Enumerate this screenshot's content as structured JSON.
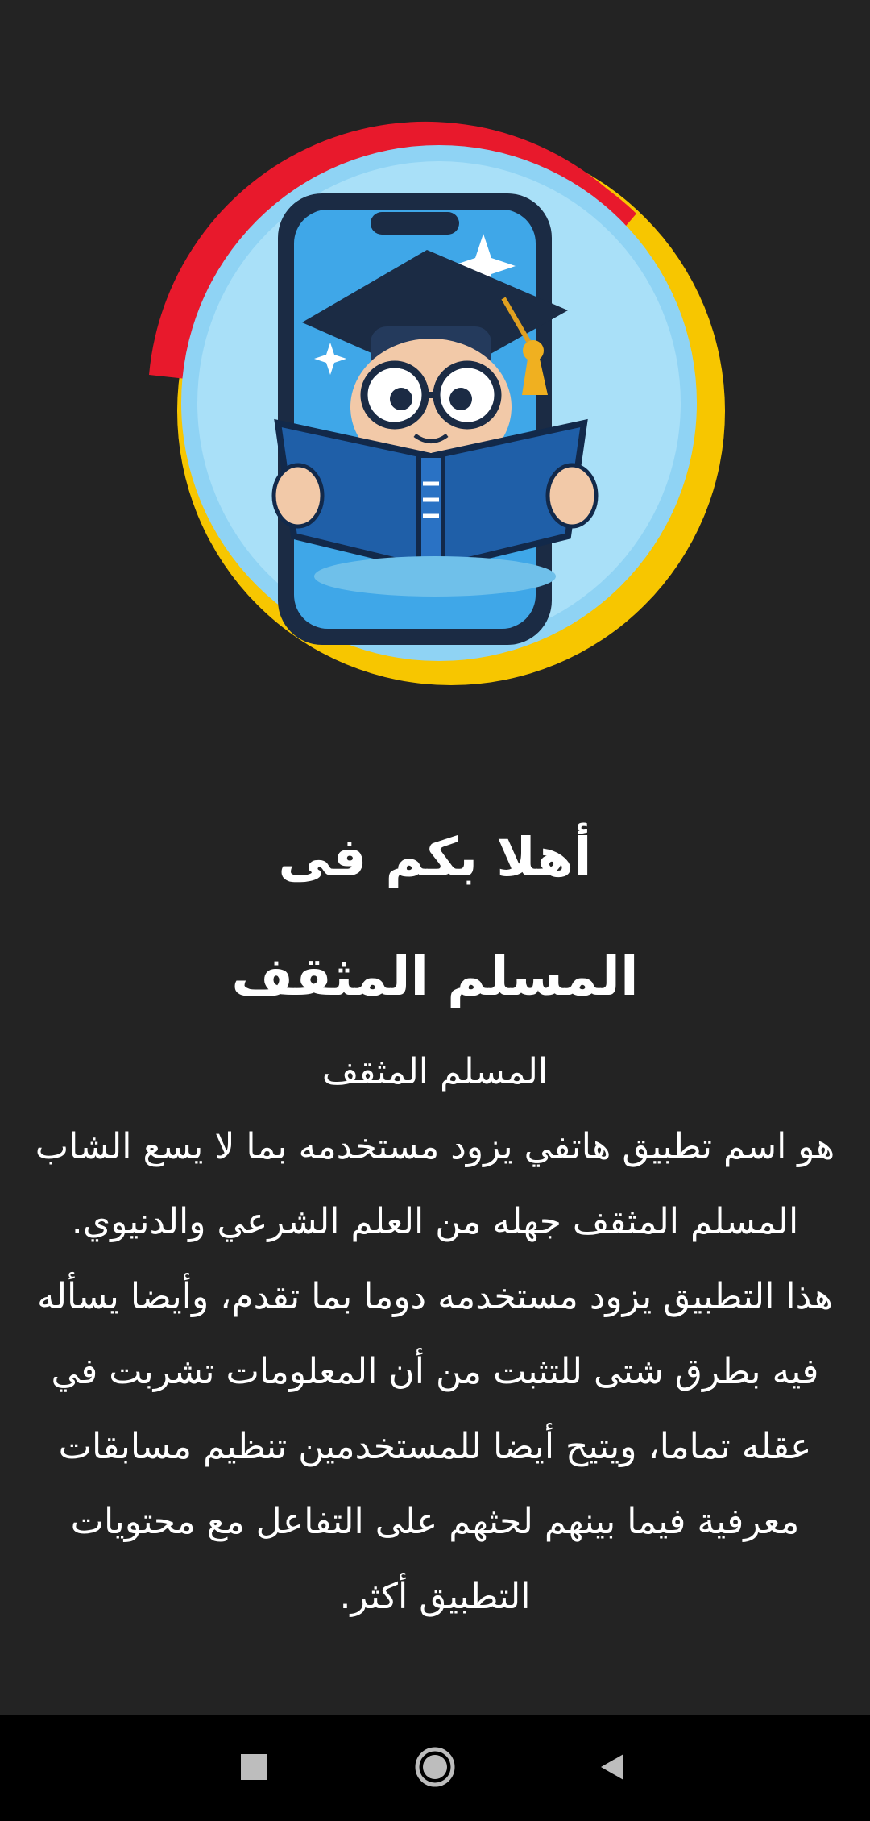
{
  "welcome": {
    "line1": "أهلا بكم فى",
    "line2": "المسلم المثقف"
  },
  "description": {
    "app_name": "المسلم المثقف",
    "paragraph1": "هو اسم تطبيق هاتفي يزود مستخدمه بما لا يسع الشاب المسلم المثقف جهله من العلم الشرعي والدنيوي.",
    "paragraph2": "هذا التطبيق يزود مستخدمه دوما بما تقدم، وأيضا يسأله فيه بطرق شتى للتثبت من أن المعلومات تشربت في عقله تماما، ويتيح أيضا للمستخدمين تنظيم مسابقات معرفية فيما بينهم لحثهم على التفاعل مع محتويات التطبيق أكثر."
  },
  "logo": {
    "icon": "student-reading-book-on-phone-logo",
    "colors": {
      "ring_red": "#e8192c",
      "ring_yellow": "#f7c600",
      "inner_circle": "#8fd3f4",
      "book_blue": "#1f5fa8"
    }
  },
  "navbar": {
    "recents_icon": "square-recents-icon",
    "home_icon": "circle-home-icon",
    "back_icon": "triangle-back-icon"
  },
  "colors": {
    "background": "#232323",
    "text": "#ffffff",
    "navbar": "#000000"
  }
}
